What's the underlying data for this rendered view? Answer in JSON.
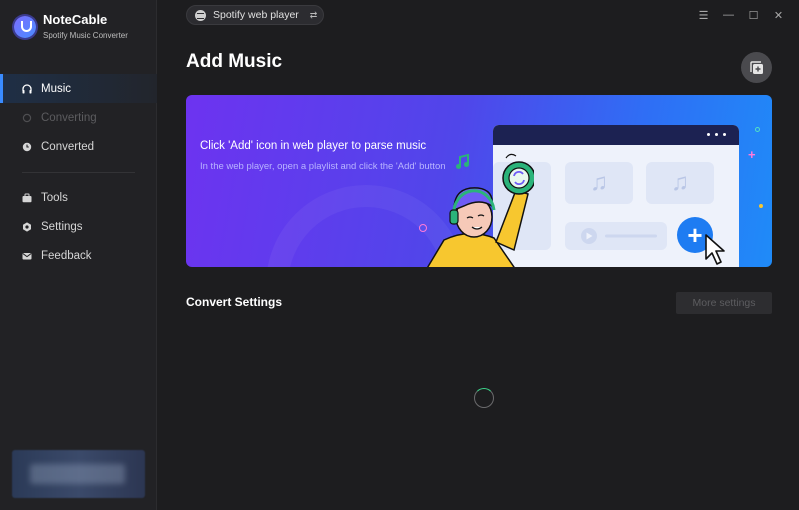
{
  "app": {
    "name": "NoteCable",
    "subtitle": "Spotify Music Converter"
  },
  "sidebar": {
    "items": [
      {
        "label": "Music",
        "icon": "headphones-icon",
        "state": "active"
      },
      {
        "label": "Converting",
        "icon": "sync-icon",
        "state": "disabled"
      },
      {
        "label": "Converted",
        "icon": "clock-icon",
        "state": "normal"
      },
      {
        "label": "Tools",
        "icon": "toolbox-icon",
        "state": "normal"
      },
      {
        "label": "Settings",
        "icon": "gear-icon",
        "state": "normal"
      },
      {
        "label": "Feedback",
        "icon": "mail-icon",
        "state": "normal"
      }
    ]
  },
  "topbar": {
    "source_label": "Spotify web player",
    "swap_icon": "⇄",
    "window_controls": [
      "☰",
      "—",
      "☐",
      "✕"
    ]
  },
  "main": {
    "title": "Add Music",
    "banner": {
      "title": "Click 'Add' icon in web player to parse music",
      "subtitle": "In the web player, open a playlist and click the 'Add' button"
    },
    "convert_settings_title": "Convert Settings",
    "more_settings_label": "More settings"
  },
  "colors": {
    "accent": "#3a8bff",
    "sidebar_bg": "#222225",
    "main_bg": "#1d1d1f",
    "banner_start": "#6d33f0",
    "banner_end": "#1f8bf8"
  }
}
